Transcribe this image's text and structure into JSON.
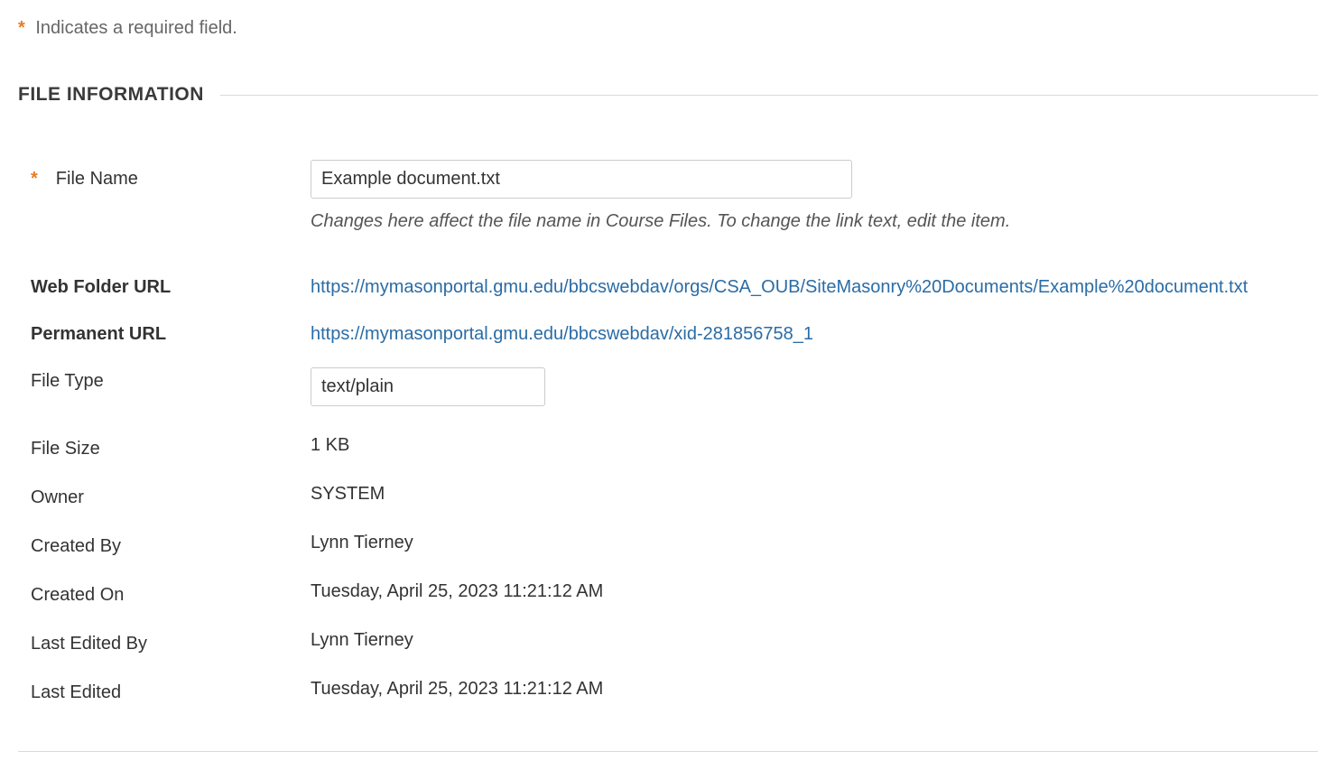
{
  "requiredHint": {
    "asterisk": "*",
    "text": " Indicates a required field."
  },
  "section": {
    "title": "FILE INFORMATION"
  },
  "fileName": {
    "label": "File Name",
    "value": "Example document.txt",
    "helper": "Changes here affect the file name in Course Files. To change the link text, edit the item."
  },
  "webFolderUrl": {
    "label": "Web Folder URL",
    "value": "https://mymasonportal.gmu.edu/bbcswebdav/orgs/CSA_OUB/SiteMasonry%20Documents/Example%20document.txt"
  },
  "permanentUrl": {
    "label": "Permanent URL",
    "value": "https://mymasonportal.gmu.edu/bbcswebdav/xid-281856758_1"
  },
  "fileType": {
    "label": "File Type",
    "value": "text/plain"
  },
  "fileSize": {
    "label": "File Size",
    "value": "1 KB"
  },
  "owner": {
    "label": "Owner",
    "value": "SYSTEM"
  },
  "createdBy": {
    "label": "Created By",
    "value": "Lynn Tierney"
  },
  "createdOn": {
    "label": "Created On",
    "value": "Tuesday, April 25, 2023 11:21:12 AM"
  },
  "lastEditedBy": {
    "label": "Last Edited By",
    "value": "Lynn Tierney"
  },
  "lastEdited": {
    "label": "Last Edited",
    "value": "Tuesday, April 25, 2023 11:21:12 AM"
  }
}
